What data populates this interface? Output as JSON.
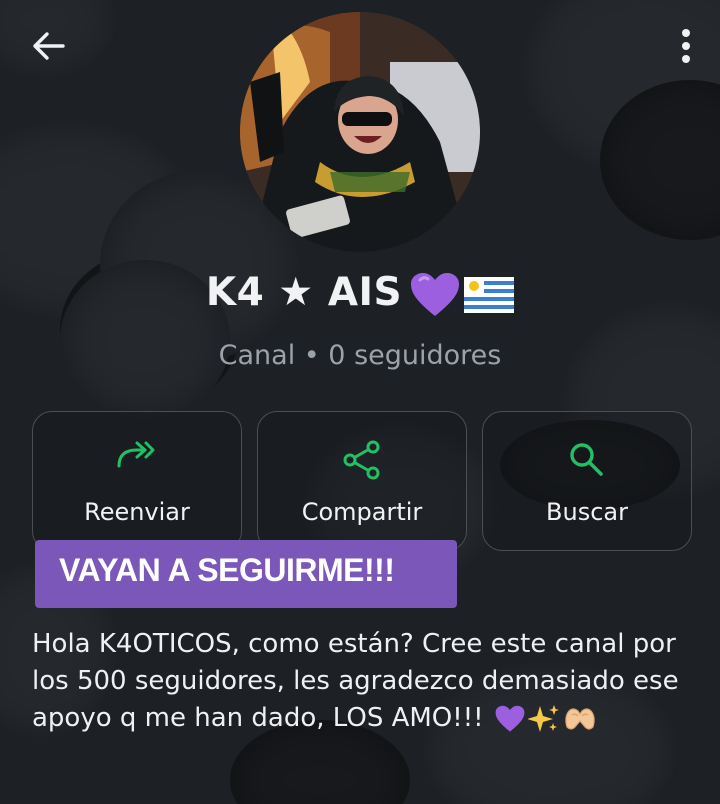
{
  "channel": {
    "name": "K4 ★ AӀS",
    "subtitle": "Canal • 0 seguidores",
    "emojis": [
      "purple-heart",
      "uruguay-flag"
    ]
  },
  "actions": [
    {
      "label": "Reenviar",
      "icon": "forward-icon"
    },
    {
      "label": "Compartir",
      "icon": "share-icon"
    },
    {
      "label": "Buscar",
      "icon": "search-icon"
    }
  ],
  "pinned_banner": "VAYAN A SEGUIRME!!!",
  "description": {
    "text": "Hola K4OTICOS, como están? Cree este canal por los 500 seguidores, les agradezco demasiado ese apoyo q me han dado, LOS AMO!!!",
    "emojis": [
      "purple-heart",
      "sparkles",
      "heart-hands"
    ]
  },
  "colors": {
    "background": "#1d2024",
    "accent_green": "#21c063",
    "banner_purple": "#7a57b9",
    "text_primary": "#f0f2f4",
    "text_secondary": "#9aa3a9"
  }
}
